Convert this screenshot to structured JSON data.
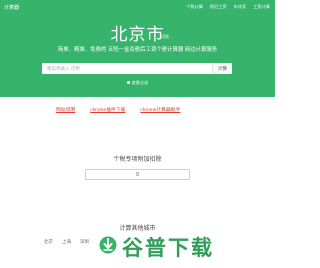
{
  "nav": {
    "logo": "计算器",
    "items": [
      "个税计算",
      "税后工资",
      "年终奖",
      "工资计算"
    ]
  },
  "header": {
    "city": "北京市",
    "switch_label": "切换",
    "subtitle": "简单、精准、免费的 五险一金及税后工资个税计算器 网边计算服务"
  },
  "search": {
    "placeholder": "税前月收入,可用",
    "button": "计算"
  },
  "view_all": "查看全部",
  "links": [
    "网站说明",
    "chrome插件下载",
    "chrome计算器助手"
  ],
  "deduction": {
    "title": "个税专项附加扣除",
    "value": "0"
  },
  "other_cities": {
    "title": "计算其他城市",
    "cities": [
      "北京",
      "上海",
      "深圳"
    ]
  },
  "watermark": {
    "text": "谷普下载",
    "icon": "download-arrow-icon"
  },
  "colors": {
    "brand_green": "#36b46c",
    "link_red": "#e53935",
    "watermark_green": "#2f9e57"
  }
}
